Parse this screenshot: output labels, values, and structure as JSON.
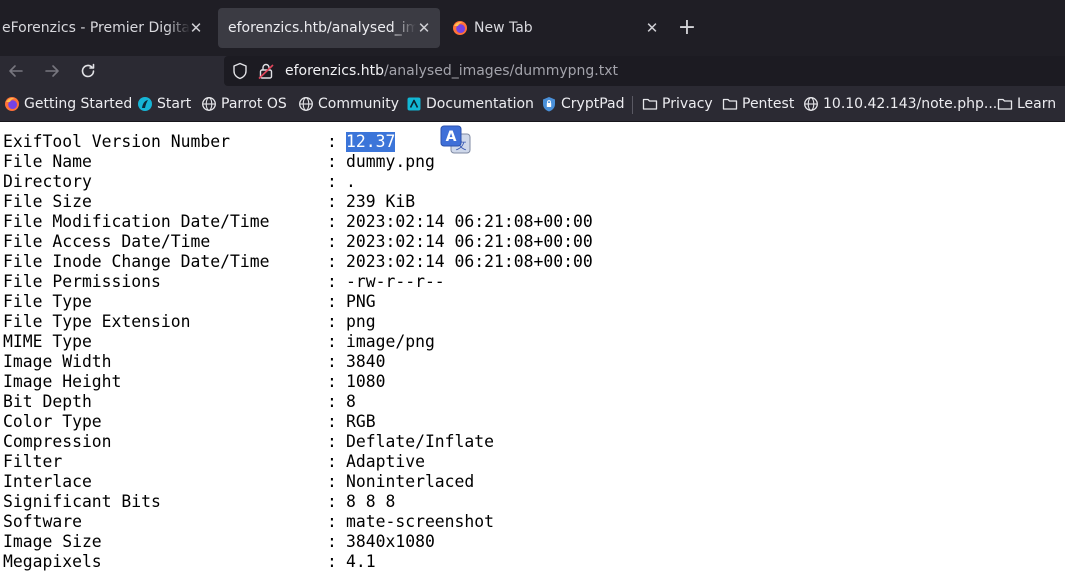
{
  "tabs": [
    {
      "title": "eForenzics - Premier Digital Forensics",
      "active": false,
      "icon": "none"
    },
    {
      "title": "eforenzics.htb/analysed_images/dummypng.txt",
      "active": true,
      "icon": "none"
    },
    {
      "title": "New Tab",
      "active": false,
      "icon": "firefox-icon"
    }
  ],
  "toolbar": {
    "close_glyph": "✕",
    "new_tab_glyph": "+"
  },
  "url": {
    "host": "eforenzics.htb",
    "path": "/analysed_images/dummypng.txt"
  },
  "bookmarks": [
    {
      "label": "Getting Started",
      "icon": "firefox-icon"
    },
    {
      "label": "Start",
      "icon": "parrot-icon"
    },
    {
      "label": "Parrot OS",
      "icon": "globe-icon"
    },
    {
      "label": "Community",
      "icon": "globe-icon"
    },
    {
      "label": "Documentation",
      "icon": "docs-icon"
    },
    {
      "label": "CryptPad",
      "icon": "shield-icon"
    },
    {
      "label": "Privacy",
      "icon": "folder-icon"
    },
    {
      "label": "Pentest",
      "icon": "folder-icon"
    },
    {
      "label": "10.10.42.143/note.php...",
      "icon": "globe-icon"
    },
    {
      "label": "Learn",
      "icon": "folder-icon"
    }
  ],
  "exif": {
    "separator": ":",
    "rows": [
      {
        "label": "ExifTool Version Number",
        "value": "12.37"
      },
      {
        "label": "File Name",
        "value": "dummy.png"
      },
      {
        "label": "Directory",
        "value": "."
      },
      {
        "label": "File Size",
        "value": "239 KiB"
      },
      {
        "label": "File Modification Date/Time",
        "value": "2023:02:14 06:21:08+00:00"
      },
      {
        "label": "File Access Date/Time",
        "value": "2023:02:14 06:21:08+00:00"
      },
      {
        "label": "File Inode Change Date/Time",
        "value": "2023:02:14 06:21:08+00:00"
      },
      {
        "label": "File Permissions",
        "value": "-rw-r--r--"
      },
      {
        "label": "File Type",
        "value": "PNG"
      },
      {
        "label": "File Type Extension",
        "value": "png"
      },
      {
        "label": "MIME Type",
        "value": "image/png"
      },
      {
        "label": "Image Width",
        "value": "3840"
      },
      {
        "label": "Image Height",
        "value": "1080"
      },
      {
        "label": "Bit Depth",
        "value": "8"
      },
      {
        "label": "Color Type",
        "value": "RGB"
      },
      {
        "label": "Compression",
        "value": "Deflate/Inflate"
      },
      {
        "label": "Filter",
        "value": "Adaptive"
      },
      {
        "label": "Interlace",
        "value": "Noninterlaced"
      },
      {
        "label": "Significant Bits",
        "value": "8 8 8"
      },
      {
        "label": "Software",
        "value": "mate-screenshot"
      },
      {
        "label": "Image Size",
        "value": "3840x1080"
      },
      {
        "label": "Megapixels",
        "value": "4.1"
      }
    ]
  },
  "translate_popup": {
    "glyph_a": "A",
    "glyph_b": "文"
  },
  "colors": {
    "selection": "#3b75d9",
    "tabstrip": "#1f1e25",
    "toolbar": "#2b2a33",
    "urlbar": "#1c1b22"
  }
}
